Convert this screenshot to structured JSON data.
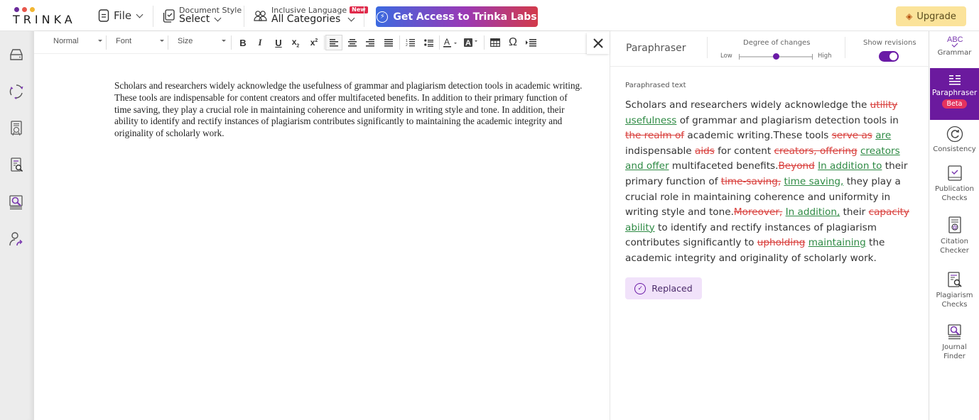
{
  "brand": {
    "name": "TRINKA",
    "dot_colors": [
      "#6a2a9a",
      "#e8574c",
      "#f2b632"
    ]
  },
  "header": {
    "file_label": "File",
    "doc_style": {
      "small": "Document Style",
      "value": "Select"
    },
    "inclusive": {
      "small": "Inclusive Language",
      "badge": "New",
      "value": "All Categories"
    },
    "labs_button": "Get Access to Trinka Labs",
    "upgrade_button": "Upgrade"
  },
  "left_sidebar": {
    "icons": [
      "drive-icon",
      "sync-icon",
      "certificate-icon",
      "document-search-icon",
      "journal-search-icon",
      "user-share-icon"
    ]
  },
  "toolbar": {
    "paragraph_style": "Normal",
    "font": "Font",
    "size": "Size",
    "buttons": [
      "bold",
      "italic",
      "underline",
      "subscript",
      "superscript",
      "align-left",
      "align-center",
      "align-right",
      "justify",
      "ordered-list",
      "bullet-list",
      "text-color",
      "highlight-color",
      "table",
      "special-character",
      "indent"
    ],
    "bold_glyph": "B",
    "italic_glyph": "I",
    "underline_glyph": "U",
    "omega_glyph": "Ω"
  },
  "document": {
    "text": "Scholars and researchers widely acknowledge the usefulness of grammar and plagiarism detection tools in academic writing. These tools are indispensable for content creators and offer multifaceted benefits. In addition to their primary function of time saving, they play a crucial role in maintaining coherence and uniformity in writing style and tone. In addition, their ability to identify and rectify instances of plagiarism contributes significantly to maintaining the academic integrity and originality of scholarly work."
  },
  "paraphraser": {
    "title": "Paraphraser",
    "degree_label": "Degree of changes",
    "degree_low": "Low",
    "degree_high": "High",
    "degree_value": 0.5,
    "show_revisions_label": "Show revisions",
    "show_revisions_on": true,
    "paraphrased_label": "Paraphrased text",
    "segments": [
      {
        "t": "Scholars and researchers widely acknowledge the ",
        "k": "n"
      },
      {
        "t": "utility",
        "k": "d"
      },
      {
        "t": " ",
        "k": "n"
      },
      {
        "t": "usefulness",
        "k": "i"
      },
      {
        "t": " of grammar and plagiarism detection tools in ",
        "k": "n"
      },
      {
        "t": "the realm of",
        "k": "d"
      },
      {
        "t": " academic writing.These tools ",
        "k": "n"
      },
      {
        "t": "serve as",
        "k": "d"
      },
      {
        "t": " ",
        "k": "n"
      },
      {
        "t": "are",
        "k": "i"
      },
      {
        "t": " indispensable ",
        "k": "n"
      },
      {
        "t": "aids",
        "k": "d"
      },
      {
        "t": " for content ",
        "k": "n"
      },
      {
        "t": "creators, offering",
        "k": "d"
      },
      {
        "t": " ",
        "k": "n"
      },
      {
        "t": "creators and offer",
        "k": "i"
      },
      {
        "t": " multifaceted benefits.",
        "k": "n"
      },
      {
        "t": "Beyond",
        "k": "d"
      },
      {
        "t": " ",
        "k": "n"
      },
      {
        "t": "In addition to",
        "k": "i"
      },
      {
        "t": " their primary function of ",
        "k": "n"
      },
      {
        "t": "time-saving,",
        "k": "d"
      },
      {
        "t": " ",
        "k": "n"
      },
      {
        "t": "time saving,",
        "k": "i"
      },
      {
        "t": " they play a crucial role in maintaining coherence and uniformity in writing style and tone.",
        "k": "n"
      },
      {
        "t": "Moreover,",
        "k": "d"
      },
      {
        "t": " ",
        "k": "n"
      },
      {
        "t": "In addition,",
        "k": "i"
      },
      {
        "t": " their ",
        "k": "n"
      },
      {
        "t": "capacity",
        "k": "d"
      },
      {
        "t": " ",
        "k": "n"
      },
      {
        "t": "ability",
        "k": "i"
      },
      {
        "t": " to identify and rectify instances of plagiarism contributes significantly to ",
        "k": "n"
      },
      {
        "t": "upholding",
        "k": "d"
      },
      {
        "t": " ",
        "k": "n"
      },
      {
        "t": "maintaining",
        "k": "i"
      },
      {
        "t": " the academic integrity and originality of scholarly work.",
        "k": "n"
      }
    ],
    "replaced_button": "Replaced"
  },
  "right_rail": {
    "items": [
      {
        "label": "Grammar",
        "icon": "abc-check-icon"
      },
      {
        "label": "Paraphraser",
        "icon": "paraphrase-icon",
        "badge": "Beta",
        "active": true
      },
      {
        "label": "Consistency",
        "icon": "consistency-icon"
      },
      {
        "label": "Publication Checks",
        "icon": "publication-check-icon"
      },
      {
        "label": "Citation Checker",
        "icon": "citation-icon"
      },
      {
        "label": "Plagiarism Checks",
        "icon": "plagiarism-icon"
      },
      {
        "label": "Journal Finder",
        "icon": "journal-finder-icon"
      }
    ]
  },
  "colors": {
    "accent_purple": "#6b1a9e",
    "deleted_red": "#d9413e",
    "inserted_green": "#2e8a44",
    "upgrade_yellow": "#fbe39a",
    "beta_pink": "#e4325e"
  }
}
